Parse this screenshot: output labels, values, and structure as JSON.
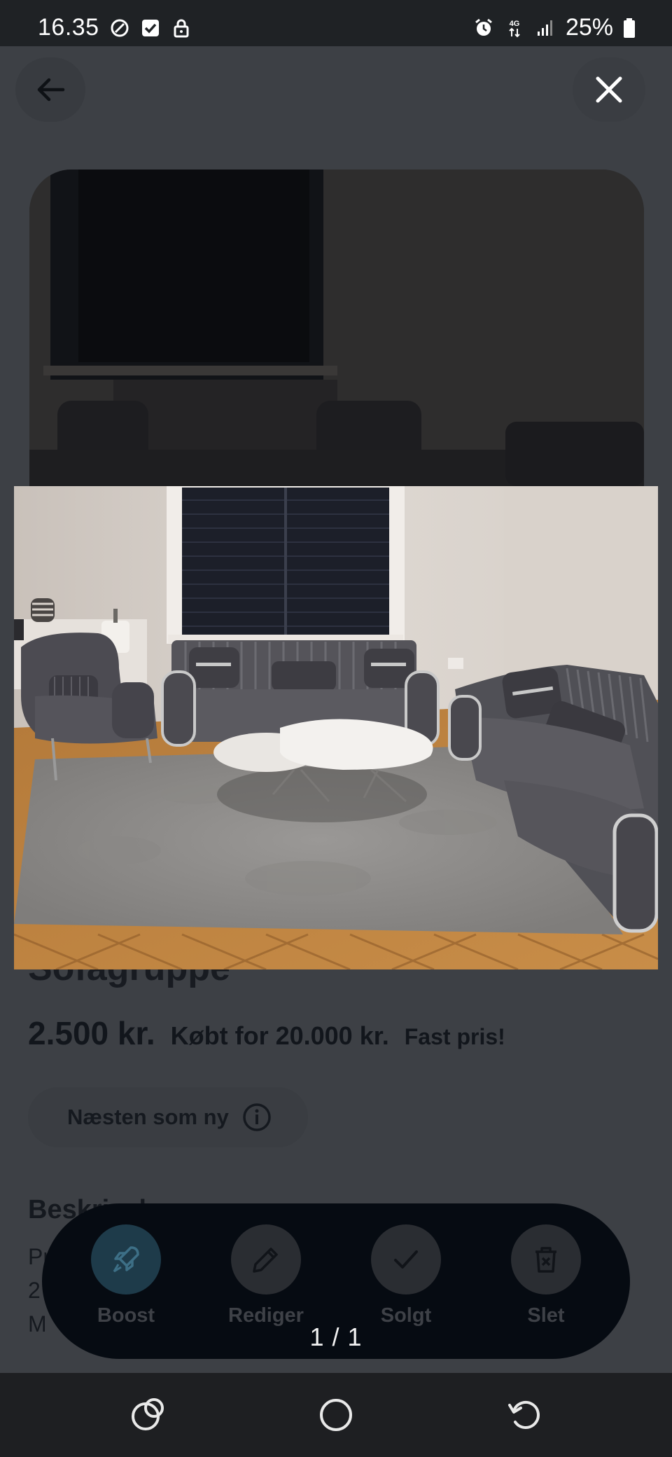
{
  "status_bar": {
    "time": "16.35",
    "battery": "25%",
    "network": "4G"
  },
  "listing": {
    "title": "Sofagruppe",
    "price": "2.500 kr.",
    "bought_for": "Købt for 20.000 kr.",
    "price_type": "Fast pris!",
    "condition": "Næsten som ny",
    "description_heading": "Beskrivelse",
    "description_lines": [
      "Pr",
      "2",
      "M"
    ]
  },
  "actions": {
    "boost": "Boost",
    "edit": "Rediger",
    "sold": "Solgt",
    "delete": "Slet"
  },
  "gallery": {
    "counter": "1 / 1"
  },
  "colors": {
    "overlay": "#3d4045",
    "action_bar": "#060b12",
    "nav_bar": "#1e1f22"
  }
}
